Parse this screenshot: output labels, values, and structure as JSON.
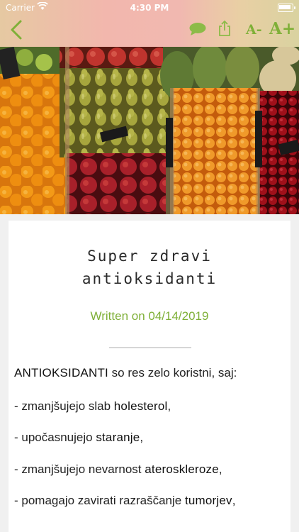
{
  "status": {
    "carrier": "Carrier",
    "time": "4:30 PM"
  },
  "toolbar": {
    "font_decrease": "A-",
    "font_increase": "A+"
  },
  "article": {
    "title_line1": "Super zdravi",
    "title_line2": "antioksidanti",
    "date": "Written on 04/14/2019",
    "intro_bold": "ANTIOKSIDANTI",
    "intro_rest": " so res zelo koristni, saj:",
    "items": [
      {
        "pre": "- zmanjšujejo slab ",
        "bold": "holesterol",
        "post": ","
      },
      {
        "pre": "- upočasnujejo ",
        "bold": "staranje",
        "post": ","
      },
      {
        "pre": "-  zmanjšujejo nevarnost ",
        "bold": "ateroskleroze",
        "post": ","
      },
      {
        "pre": "- pomagajo zavirati razraščanje ",
        "bold": "tumorjev",
        "post": ","
      }
    ]
  },
  "colors": {
    "accent": "#7fb038"
  },
  "icons": [
    "back-chevron-icon",
    "chat-bubble-icon",
    "share-icon",
    "font-decrease-icon",
    "font-increase-icon"
  ]
}
